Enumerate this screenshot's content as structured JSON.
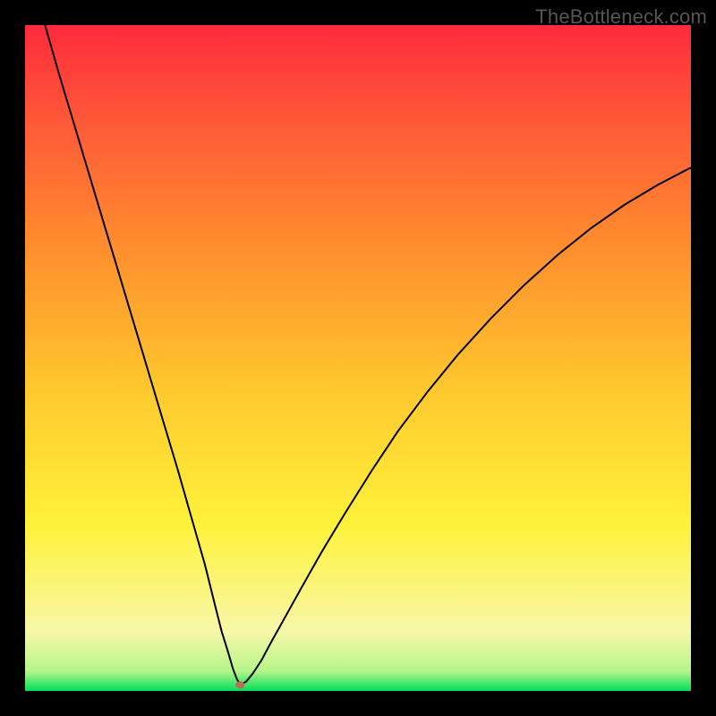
{
  "watermark": "TheBottleneck.com",
  "chart_data": {
    "type": "line",
    "title": "",
    "xlabel": "",
    "ylabel": "",
    "xlim": [
      0,
      100
    ],
    "ylim": [
      0,
      100
    ],
    "gradient_stops": [
      {
        "offset": 0.0,
        "color": "#00e05a"
      },
      {
        "offset": 0.03,
        "color": "#b7f58a"
      },
      {
        "offset": 0.09,
        "color": "#f8f7a8"
      },
      {
        "offset": 0.25,
        "color": "#fff23a"
      },
      {
        "offset": 0.45,
        "color": "#ffc92e"
      },
      {
        "offset": 0.68,
        "color": "#ff8a2e"
      },
      {
        "offset": 0.85,
        "color": "#ff5a38"
      },
      {
        "offset": 1.0,
        "color": "#ff2a3c"
      }
    ],
    "series": [
      {
        "name": "bottleneck-curve",
        "stroke": "#000000",
        "stroke_width": 2,
        "x": [
          3,
          5,
          8,
          11,
          14,
          17,
          20,
          23,
          25,
          27,
          28.5,
          29.5,
          30.5,
          31.2,
          31.8,
          32.3,
          32.3,
          33.2,
          34.2,
          35.5,
          37,
          39,
          41.5,
          44.5,
          48,
          52,
          56,
          60.5,
          65,
          70,
          75,
          80,
          85,
          90,
          95,
          100
        ],
        "y": [
          100,
          93,
          83,
          73,
          63,
          53,
          43,
          33,
          26,
          19,
          13,
          9,
          5.8,
          3.4,
          1.8,
          0.9,
          0.9,
          1.4,
          2.6,
          4.6,
          7.4,
          11,
          15.5,
          20.8,
          26.6,
          33,
          39,
          45,
          50.5,
          56,
          61,
          65.5,
          69.5,
          73,
          76,
          78.6
        ]
      }
    ],
    "marker": {
      "name": "min-marker",
      "x": 32.3,
      "y": 0.9,
      "rx": 5,
      "ry": 4,
      "fill": "#c06a5a"
    }
  }
}
